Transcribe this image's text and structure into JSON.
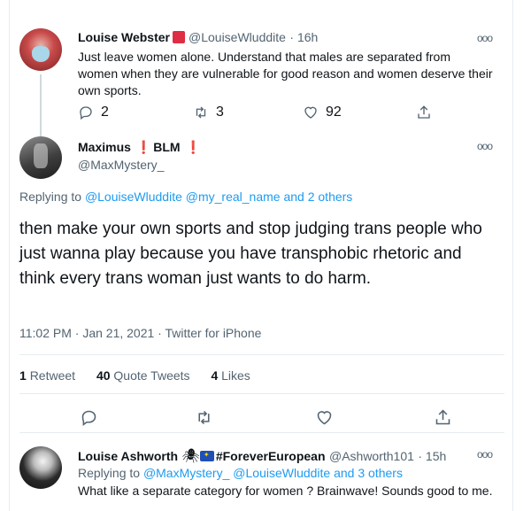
{
  "tweet_top": {
    "name": "Louise Webster",
    "handle": "@LouiseWluddite",
    "time": "· 16h",
    "body": "Just leave women alone. Understand that males are separated from women when they are vulnerable for good reason and women deserve their own sports.",
    "reply_count": "2",
    "retweet_count": "3",
    "like_count": "92",
    "more_label": "ooo"
  },
  "main_tweet": {
    "name": "Maximus",
    "name_extra": "BLM",
    "excl": "❗",
    "handle": "@MaxMystery_",
    "more_label": "ooo",
    "replying_prefix": "Replying to",
    "replying_user1": "@LouiseWluddite",
    "replying_user2": "@my_real_name",
    "replying_and": "and",
    "replying_others": "2 others",
    "text": "then make your own sports and stop judging trans people who just wanna play because you have transphobic rhetoric and think every trans woman just wants to do harm.",
    "timestamp": "11:02 PM · Jan 21, 2021 · Twitter for iPhone",
    "stats": {
      "retweets_num": "1",
      "retweets_label": "Retweet",
      "quotes_num": "40",
      "quotes_label": "Quote Tweets",
      "likes_num": "4",
      "likes_label": "Likes"
    }
  },
  "reply3": {
    "name": "Louise Ashworth",
    "spider": "🕷",
    "hashtag": "#ForeverEuropean",
    "handle": "@Ashworth101",
    "time": "· 15h",
    "more_label": "ooo",
    "replying_prefix": "Replying to",
    "replying_user1": "@MaxMystery_",
    "replying_user2": "@LouiseWluddite",
    "replying_and": "and",
    "replying_others": "3 others",
    "body": "What like a separate category for women ? Brainwave! Sounds good to me."
  },
  "icons": {
    "reply": "reply-icon",
    "retweet": "retweet-icon",
    "like": "heart-icon",
    "share": "share-icon"
  },
  "colors": {
    "accent": "#1d9bf0",
    "text": "#0f1419",
    "muted": "#536471",
    "flag_red": "#dd2e44"
  }
}
